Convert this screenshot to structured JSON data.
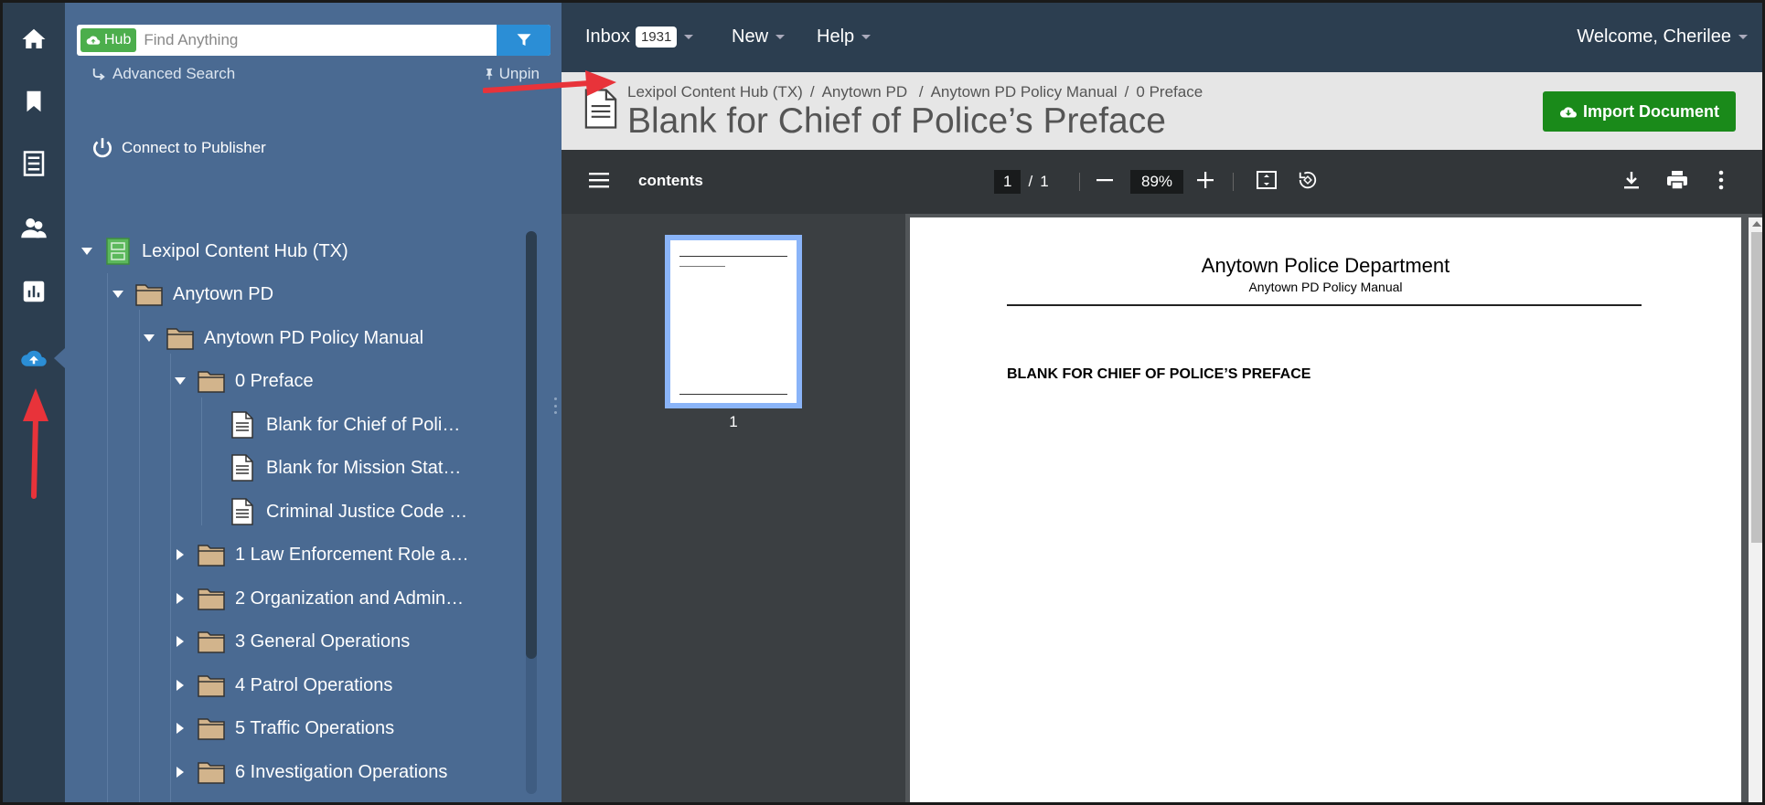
{
  "search": {
    "hub_label": "Hub",
    "placeholder": "Find Anything",
    "advanced_label": "Advanced Search",
    "unpin_label": "Unpin"
  },
  "connect_label": "Connect to Publisher",
  "tree": {
    "items": [
      {
        "label": "Lexipol Content Hub (TX)",
        "type": "cabinet",
        "expanded": true
      },
      {
        "label": "Anytown PD",
        "type": "folder",
        "expanded": true
      },
      {
        "label": "Anytown PD Policy Manual",
        "type": "folder",
        "expanded": true
      },
      {
        "label": "0 Preface",
        "type": "folder",
        "expanded": true
      },
      {
        "label": "Blank for Chief of Poli…",
        "type": "document"
      },
      {
        "label": "Blank for Mission Stat…",
        "type": "document"
      },
      {
        "label": "Criminal Justice Code …",
        "type": "document"
      },
      {
        "label": "1 Law Enforcement Role a…",
        "type": "folder",
        "expanded": false
      },
      {
        "label": "2 Organization and Admin…",
        "type": "folder",
        "expanded": false
      },
      {
        "label": "3 General Operations",
        "type": "folder",
        "expanded": false
      },
      {
        "label": "4 Patrol Operations",
        "type": "folder",
        "expanded": false
      },
      {
        "label": "5 Traffic Operations",
        "type": "folder",
        "expanded": false
      },
      {
        "label": "6 Investigation Operations",
        "type": "folder",
        "expanded": false
      }
    ]
  },
  "topnav": {
    "inbox_label": "Inbox",
    "inbox_count": "1931",
    "new_label": "New",
    "help_label": "Help",
    "welcome": "Welcome, Cherilee"
  },
  "header": {
    "breadcrumb": [
      "Lexipol Content Hub (TX)",
      "Anytown PD",
      "Anytown PD Policy Manual",
      "0 Preface"
    ],
    "title": "Blank for Chief of Police’s Preface",
    "import_label": "Import Document"
  },
  "pdf": {
    "contents_label": "contents",
    "current_page": "1",
    "page_sep": "/",
    "total_pages": "1",
    "zoom": "89%",
    "thumb_label": "1",
    "page_dept": "Anytown Police Department",
    "page_manual": "Anytown PD Policy Manual",
    "page_heading": "BLANK FOR CHIEF OF POLICE’S PREFACE"
  },
  "colors": {
    "rail_bg": "#2c3e50",
    "tree_bg": "#4a6a92",
    "accent_blue": "#2b8ed6",
    "hub_green": "#4cae4c",
    "import_green": "#1a8a1a",
    "annotation_red": "#e8333a"
  },
  "icons": [
    "home-icon",
    "bookmark-icon",
    "cabinet-icon",
    "users-icon",
    "chart-icon",
    "cloud-upload-icon",
    "filter-icon",
    "pin-icon",
    "power-icon",
    "document-icon",
    "folder-icon",
    "menu-icon",
    "download-icon",
    "print-icon",
    "more-vert-icon",
    "fit-page-icon",
    "rotate-icon"
  ]
}
